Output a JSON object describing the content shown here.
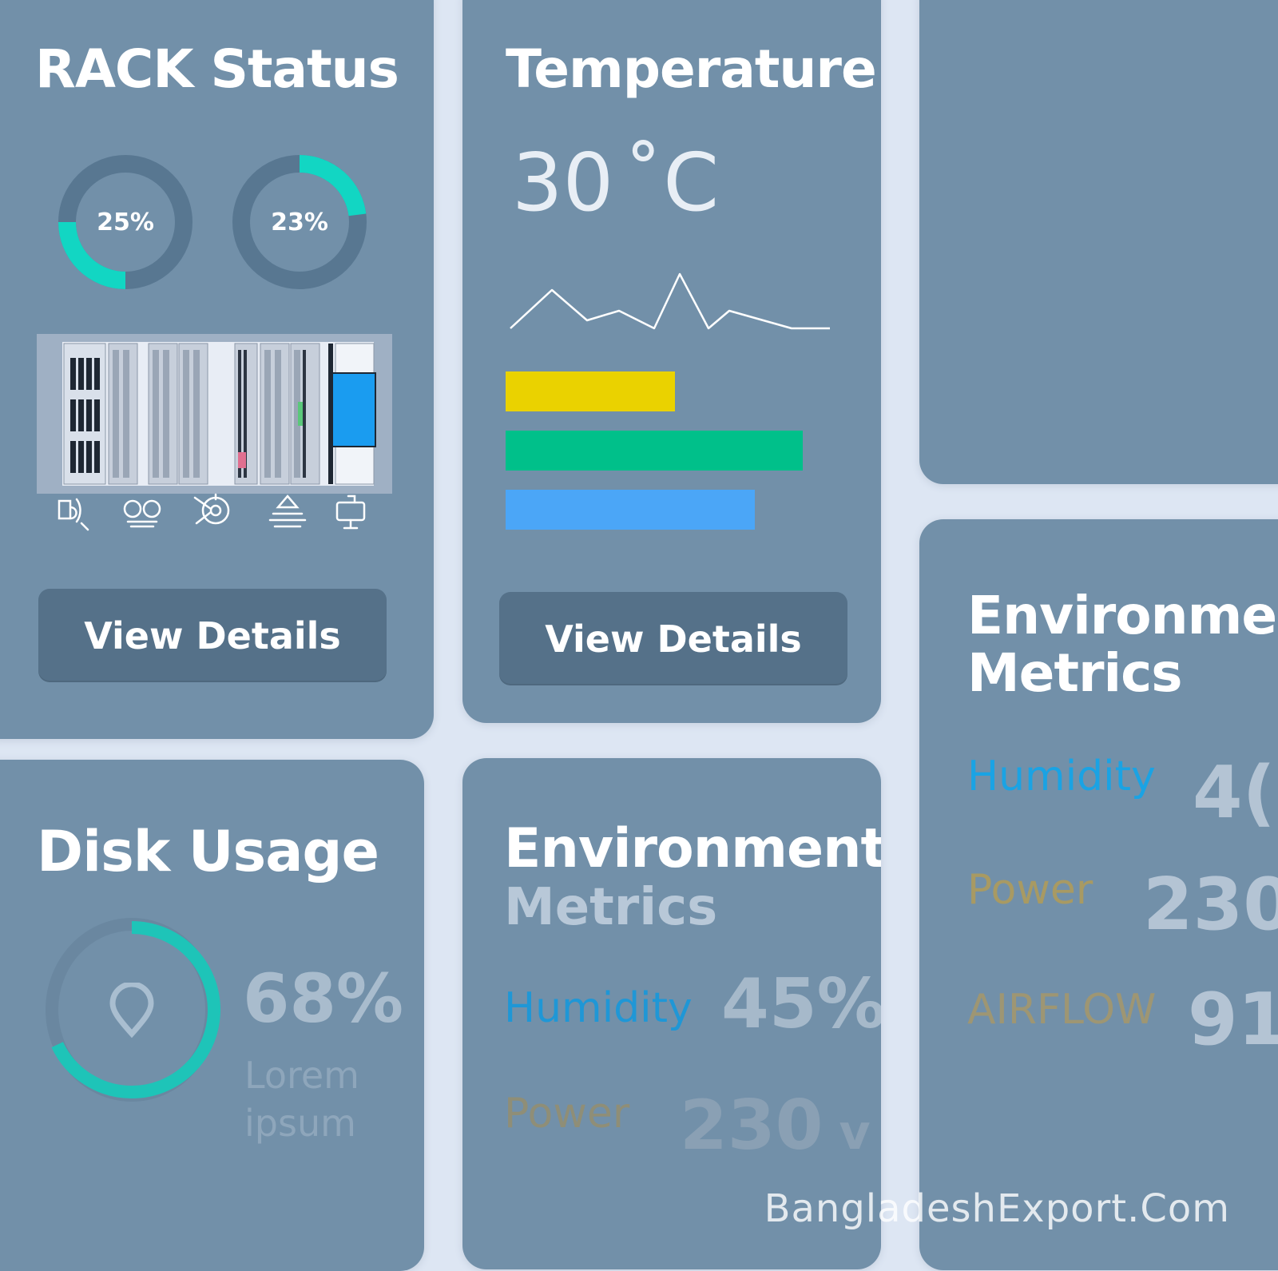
{
  "rack_status": {
    "title": "RACK Status",
    "gauges": [
      {
        "label": "25%",
        "value": 0.25
      },
      {
        "label": "23%",
        "value": 0.23
      }
    ],
    "icons": [
      "cable-icon",
      "tape-icon",
      "fan-icon",
      "power-stack-icon",
      "monitor-icon"
    ],
    "button": "View Details"
  },
  "temperature": {
    "title": "Temperature",
    "value": "30",
    "unit": "˚C",
    "bars": [
      {
        "value": 0.53,
        "color": "#ead200"
      },
      {
        "value": 0.93,
        "color": "#00c08a"
      },
      {
        "value": 0.78,
        "color": "#4ba6f7"
      }
    ],
    "button": "View Details"
  },
  "disk_usage": {
    "title": "Disk Usage",
    "value": "68%",
    "fraction": 0.68,
    "caption_line1": "Lorem",
    "caption_line2": "ipsum"
  },
  "env_center": {
    "title_line1": "Environmental",
    "title_line2": "Metrics",
    "humidity_label": "Humidity",
    "humidity_value": "45%",
    "power_label": "Power",
    "power_value": "230",
    "power_unit": "v"
  },
  "env_right": {
    "title_line1": "Environmental",
    "title_line2": "Metrics",
    "humidity_label": "Humidity",
    "humidity_value": "4(",
    "power_label": "Power",
    "power_value": "230",
    "airflow_label": "AIRFLOW",
    "airflow_value": "91"
  },
  "watermark": "BangladeshExport.Com",
  "colors": {
    "card": "#7290a9",
    "button": "#557189",
    "accent_teal": "#12d6c3",
    "humidity_blue": "#1aa3e4",
    "power_gold": "#a89a63"
  }
}
